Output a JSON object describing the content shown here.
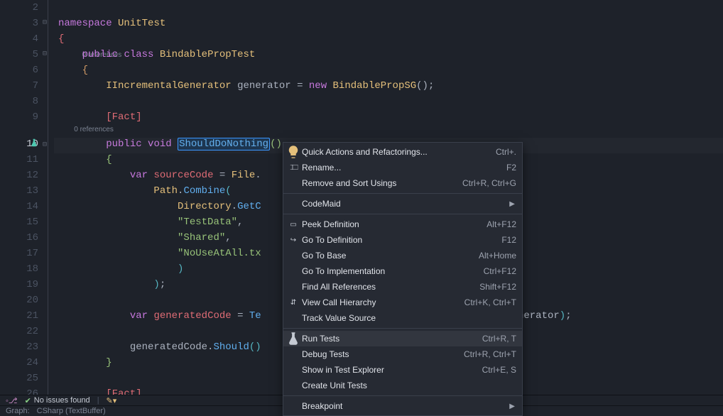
{
  "gutter": {
    "lines": [
      "2",
      "3",
      "4",
      "5",
      "6",
      "7",
      "8",
      "9",
      "10",
      "11",
      "12",
      "13",
      "14",
      "15",
      "16",
      "17",
      "18",
      "19",
      "20",
      "21",
      "22",
      "23",
      "24",
      "25",
      "26"
    ],
    "highlighted": "10"
  },
  "codelens": {
    "text": "0 references"
  },
  "code": {
    "namespace_kw": "namespace",
    "namespace_name": "UnitTest",
    "public_kw": "public",
    "class_kw": "class",
    "class_name": "BindablePropTest",
    "itf": "IIncrementalGenerator",
    "gen_var": "generator",
    "new_kw": "new",
    "gen_ctor": "BindablePropSG",
    "fact": "[Fact]",
    "void_kw": "void",
    "method_name": "ShouldDoNothing",
    "var_kw": "var",
    "src_var": "sourceCode",
    "file_cls": "File",
    "path_cls": "Path",
    "combine_fn": "Combine",
    "dir_cls": "Directory",
    "getc_fn": "GetC",
    "str_testdata": "\"TestData\"",
    "str_shared": "\"Shared\"",
    "str_nouse": "\"NoUseAtAll.tx",
    "gen_var2": "generatedCode",
    "test_fn": "Te",
    "should_fn": "Should",
    "gen_tail": "generator"
  },
  "menu": {
    "items": [
      {
        "icon": "bulb",
        "label": "Quick Actions and Refactorings...",
        "shortcut": "Ctrl+."
      },
      {
        "icon": "rename",
        "label": "Rename...",
        "shortcut": "F2"
      },
      {
        "icon": "",
        "label": "Remove and Sort Usings",
        "shortcut": "Ctrl+R, Ctrl+G"
      },
      {
        "sep": true
      },
      {
        "icon": "",
        "label": "CodeMaid",
        "shortcut": "",
        "submenu": true
      },
      {
        "sep": true
      },
      {
        "icon": "peek",
        "label": "Peek Definition",
        "shortcut": "Alt+F12"
      },
      {
        "icon": "goto",
        "label": "Go To Definition",
        "shortcut": "F12"
      },
      {
        "icon": "",
        "label": "Go To Base",
        "shortcut": "Alt+Home"
      },
      {
        "icon": "",
        "label": "Go To Implementation",
        "shortcut": "Ctrl+F12"
      },
      {
        "icon": "",
        "label": "Find All References",
        "shortcut": "Shift+F12"
      },
      {
        "icon": "hier",
        "label": "View Call Hierarchy",
        "shortcut": "Ctrl+K, Ctrl+T"
      },
      {
        "icon": "",
        "label": "Track Value Source",
        "shortcut": ""
      },
      {
        "sep": true
      },
      {
        "icon": "flask",
        "label": "Run Tests",
        "shortcut": "Ctrl+R, T",
        "hov": true
      },
      {
        "icon": "",
        "label": "Debug Tests",
        "shortcut": "Ctrl+R, Ctrl+T"
      },
      {
        "icon": "",
        "label": "Show in Test Explorer",
        "shortcut": "Ctrl+E, S"
      },
      {
        "icon": "",
        "label": "Create Unit Tests",
        "shortcut": ""
      },
      {
        "sep": true
      },
      {
        "icon": "",
        "label": "Breakpoint",
        "shortcut": "",
        "submenu": true
      }
    ]
  },
  "status": {
    "issues": "No issues found",
    "graph_label": "Graph:",
    "graph_value": "CSharp (TextBuffer)"
  }
}
